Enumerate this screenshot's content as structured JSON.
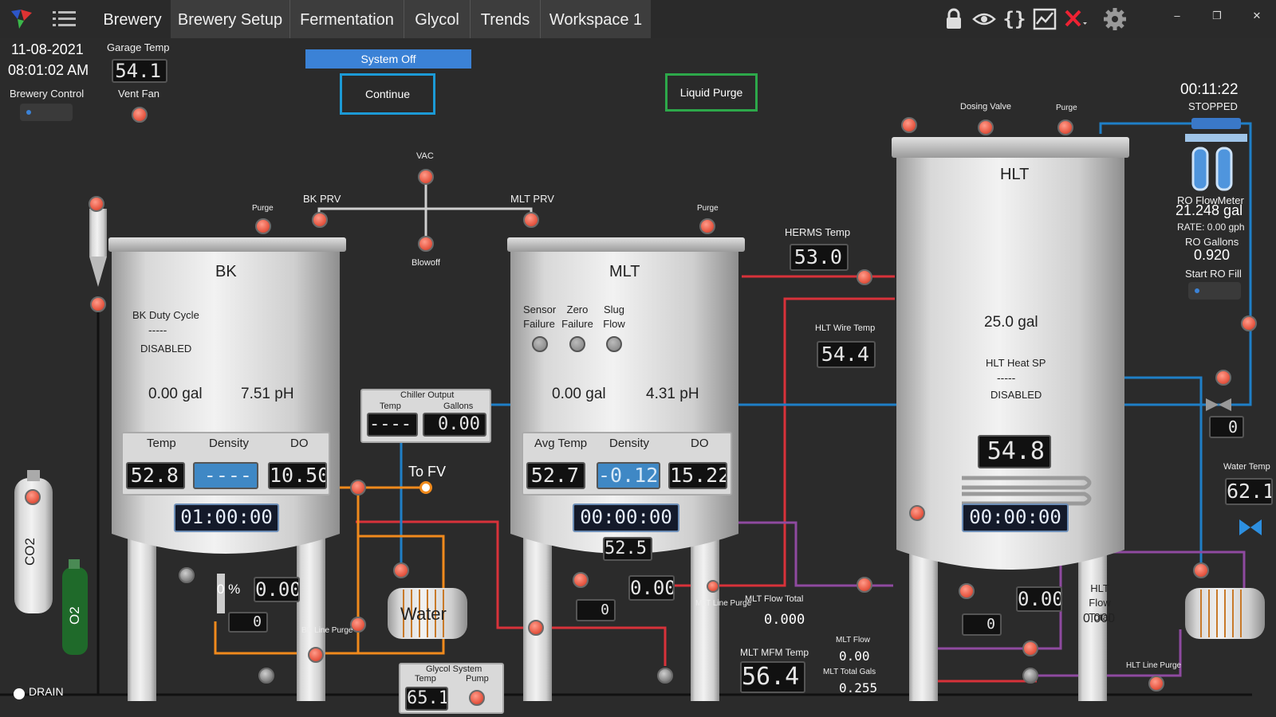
{
  "nav": {
    "tabs": [
      "Brewery",
      "Brewery Setup",
      "Fermentation",
      "Glycol",
      "Trends",
      "Workspace 1"
    ]
  },
  "header": {
    "date": "11-08-2021",
    "time": "08:01:02 AM",
    "brewery_control_label": "Brewery Control",
    "garage_temp_label": "Garage Temp",
    "garage_temp": "54.1",
    "vent_fan_label": "Vent Fan"
  },
  "controls": {
    "system_status": "System Off",
    "continue_label": "Continue",
    "liquid_purge_label": "Liquid Purge"
  },
  "timer": {
    "elapsed": "00:11:22",
    "state": "STOPPED"
  },
  "ro": {
    "flowmeter_label": "RO FlowMeter",
    "flowmeter_value": "21.248 gal",
    "rate": "RATE: 0.00 gph",
    "gallons_label": "RO Gallons",
    "gallons_value": "0.920",
    "start_fill_label": "Start RO Fill"
  },
  "valves": {
    "vac": "VAC",
    "bk_prv": "BK PRV",
    "mlt_prv": "MLT PRV",
    "blowoff": "Blowoff",
    "purge": "Purge",
    "dosing_valve": "Dosing Valve",
    "bk_line_purge": "BK Line Purge",
    "mlt_line_purge": "MLT Line Purge",
    "hlt_line_purge": "HLT Line Purge"
  },
  "bk": {
    "name": "BK",
    "duty_label": "BK Duty Cycle",
    "duty_value": "-----",
    "duty_status": "DISABLED",
    "volume": "0.00 gal",
    "ph": "7.51 pH",
    "col_temp": "Temp",
    "col_density": "Density",
    "col_do": "DO",
    "temp": "52.8",
    "density": "----",
    "do": "10.50",
    "timer": "01:00:00",
    "valve_pct": "0 %",
    "flow": "0.00",
    "counter": "0"
  },
  "mlt": {
    "name": "MLT",
    "sensor_failure": "Sensor Failure",
    "zero_failure": "Zero Failure",
    "slug_flow": "Slug Flow",
    "volume": "0.00 gal",
    "ph": "4.31 pH",
    "col_temp": "Avg Temp",
    "col_density": "Density",
    "col_do": "DO",
    "temp": "52.7",
    "density": "-0.12",
    "do": "15.22",
    "timer": "00:00:00",
    "bottom_temp": "52.5",
    "flow": "0.00",
    "counter": "0",
    "flow_total_label": "MLT Flow Total",
    "flow_total": "0.000",
    "mfm_temp_label": "MLT MFM Temp",
    "mfm_temp": "56.4",
    "mlt_flow_label": "MLT Flow",
    "mlt_flow": "0.00",
    "total_gals_label": "MLT Total Gals",
    "total_gals": "0.255"
  },
  "chiller": {
    "title": "Chiller Output",
    "temp_label": "Temp",
    "gallons_label": "Gallons",
    "temp": "----",
    "gallons": "0.00",
    "to_fv": "To FV",
    "water_label": "Water"
  },
  "glycol": {
    "title": "Glycol System",
    "temp_label": "Temp",
    "pump_label": "Pump",
    "temp": "65.1"
  },
  "hlt": {
    "name": "HLT",
    "volume": "25.0 gal",
    "heat_sp_label": "HLT Heat SP",
    "heat_sp_value": "-----",
    "heat_sp_status": "DISABLED",
    "temp": "54.8",
    "timer": "00:00:00",
    "herms_temp_label": "HERMS Temp",
    "herms_temp": "53.0",
    "wire_temp_label": "HLT Wire Temp",
    "wire_temp": "54.4",
    "flow": "0.00",
    "counter": "0",
    "flow_total_label": "HLT Flow Total",
    "flow_total": "0.000",
    "water_temp_label": "Water Temp",
    "water_temp": "62.1",
    "right_counter": "0"
  },
  "gas": {
    "co2": "CO2",
    "o2": "O2"
  },
  "drain_label": "DRAIN",
  "colors": {
    "pipe_red": "#d8323a",
    "pipe_blue": "#1f7fc7",
    "pipe_orange": "#f08a1c",
    "pipe_purple": "#8f4aa0",
    "continue_border": "#1c9ad6",
    "purge_border": "#2da84a"
  }
}
